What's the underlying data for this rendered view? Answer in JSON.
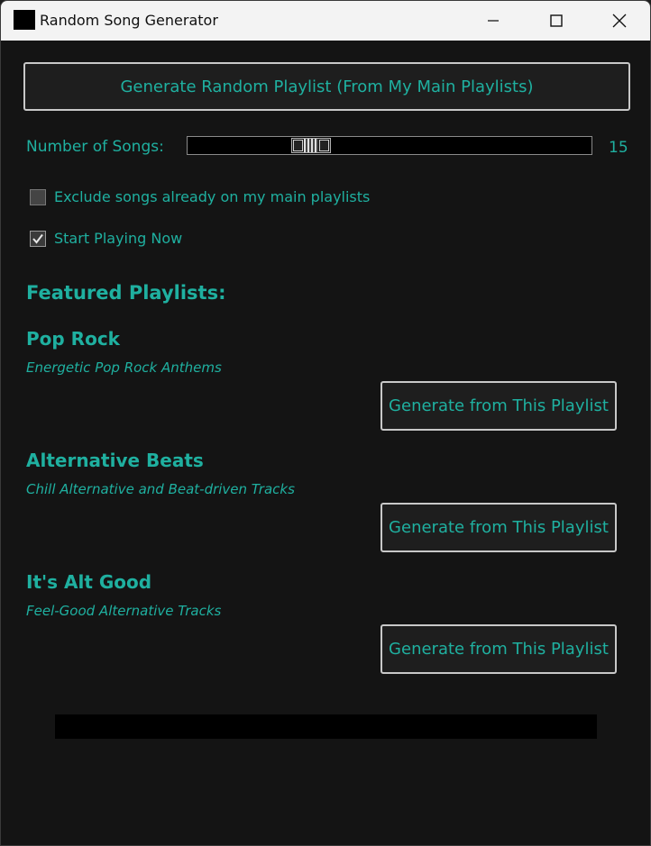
{
  "window": {
    "title": "Random Song Generator"
  },
  "main_button": {
    "label": "Generate Random Playlist (From My Main Playlists)"
  },
  "songs": {
    "label": "Number of Songs:",
    "value": "15"
  },
  "options": [
    {
      "label": "Exclude songs already on my main playlists",
      "checked": false
    },
    {
      "label": "Start Playing Now",
      "checked": true
    }
  ],
  "featured": {
    "title": "Featured Playlists:",
    "playlists": [
      {
        "name": "Pop Rock",
        "description": "Energetic Pop Rock Anthems",
        "button_label": "Generate from This Playlist"
      },
      {
        "name": "Alternative Beats",
        "description": "Chill Alternative and Beat-driven Tracks",
        "button_label": "Generate from This Playlist"
      },
      {
        "name": "It's Alt Good",
        "description": "Feel-Good Alternative Tracks",
        "button_label": "Generate from This Playlist"
      }
    ]
  },
  "colors": {
    "accent": "#1fb0a0",
    "background": "#141414",
    "button_bg": "#1e1e1e",
    "button_border": "#c8c8c8"
  },
  "icons": {
    "app": "app-icon",
    "minimize": "minimize-icon",
    "maximize": "maximize-icon",
    "close": "close-icon",
    "check": "checkmark-icon"
  },
  "progress": {
    "fraction": 0
  }
}
